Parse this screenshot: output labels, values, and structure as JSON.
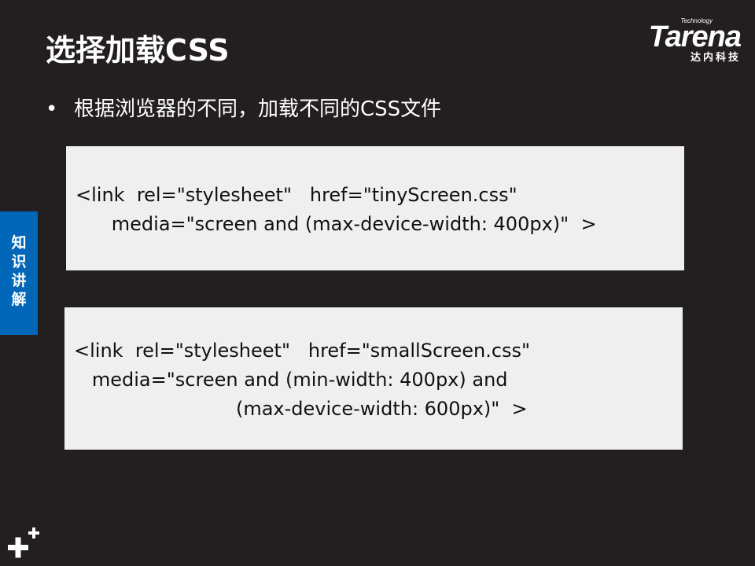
{
  "slide": {
    "title": "选择加载CSS",
    "bullet_marker": "•",
    "bullet_text": "根据浏览器的不同，加载不同的CSS文件"
  },
  "logo": {
    "tagline": "Technology",
    "name": "Tarena",
    "chinese": "达内科技"
  },
  "code_blocks": [
    {
      "lines": [
        "<link  rel=\"stylesheet\"   href=\"tinyScreen.css\"",
        "      media=\"screen and (max-device-width: 400px)\"  >"
      ]
    },
    {
      "lines": [
        "<link  rel=\"stylesheet\"   href=\"smallScreen.css\"",
        "   media=\"screen and (min-width: 400px) and",
        "                           (max-device-width: 600px)\"  >"
      ]
    }
  ],
  "side_tab": {
    "chars": [
      "知",
      "识",
      "讲",
      "解"
    ]
  },
  "colors": {
    "background": "#231f20",
    "code_box": "#efefef",
    "side_tab": "#0067b8"
  },
  "icons": {
    "corner_mark": "plus-cluster-icon"
  }
}
